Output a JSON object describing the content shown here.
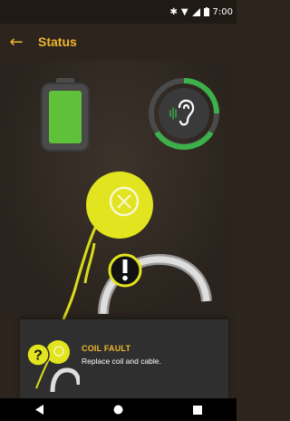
{
  "statusbar": {
    "time": "7:00",
    "icons": [
      "bluetooth-icon",
      "wifi-icon",
      "signal-icon",
      "battery-icon"
    ]
  },
  "header": {
    "title": "Status",
    "back_icon": "arrow-left-icon"
  },
  "battery_indicator": {
    "icon": "battery-icon",
    "level": 1.0,
    "color": "#5fc13a"
  },
  "hearing_indicator": {
    "icon": "hearing-icon",
    "ring_color": "#3cb14a"
  },
  "alert": {
    "title": "COIL FAULT",
    "message": "Replace coil and cable.",
    "icon": "question-warning-icon",
    "accent_color": "#f0b72e"
  },
  "navbar": {
    "back": "nav-back-icon",
    "home": "nav-home-icon",
    "recents": "nav-recents-icon"
  }
}
